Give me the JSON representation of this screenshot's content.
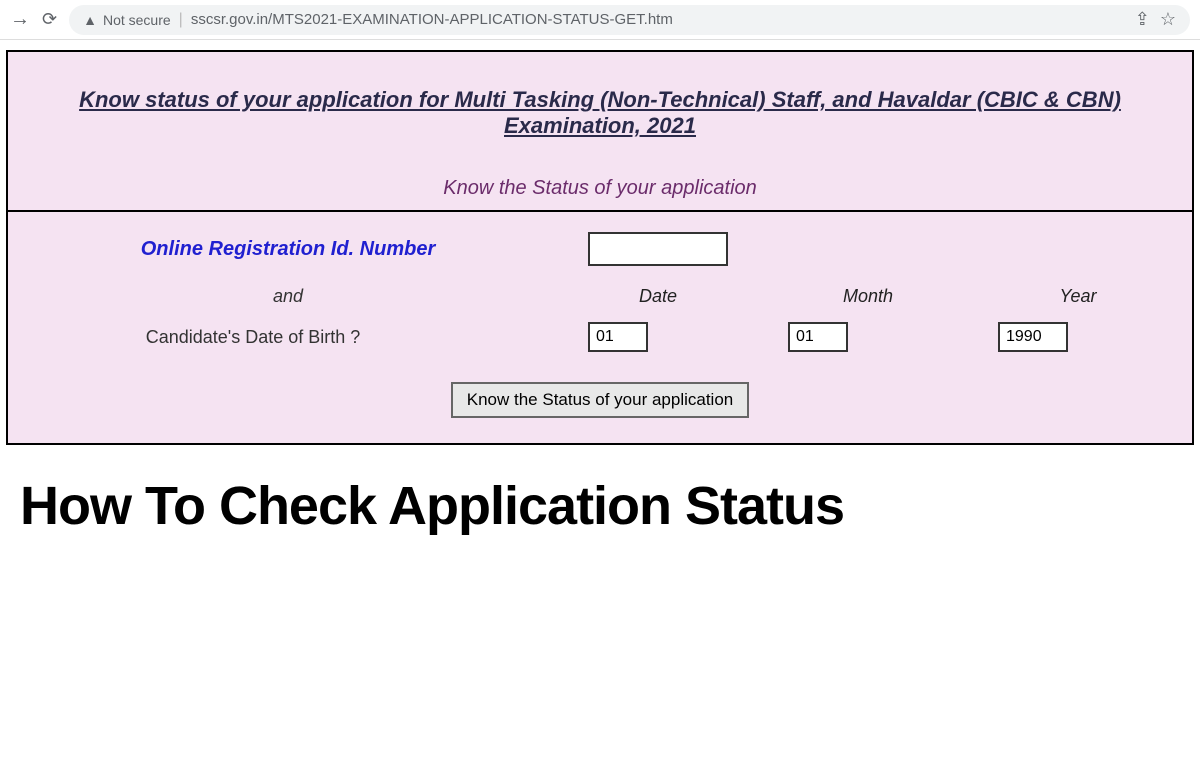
{
  "browser": {
    "security_text": "Not secure",
    "url": "sscsr.gov.in/MTS2021-EXAMINATION-APPLICATION-STATUS-GET.htm"
  },
  "page": {
    "main_title": "Know status of your application  for Multi Tasking (Non-Technical) Staff, and Havaldar (CBIC & CBN) Examination, 2021",
    "subtitle": "Know the Status of your application",
    "reg_label": "Online Registration Id. Number",
    "reg_value": "",
    "and_text": "and",
    "dob_question": "Candidate's Date of Birth ?",
    "date_header": "Date",
    "month_header": "Month",
    "year_header": "Year",
    "date_value": "01",
    "month_value": "01",
    "year_value": "1990",
    "submit_label": "Know  the Status of your application"
  },
  "footer": {
    "title": "How To Check Application Status"
  }
}
